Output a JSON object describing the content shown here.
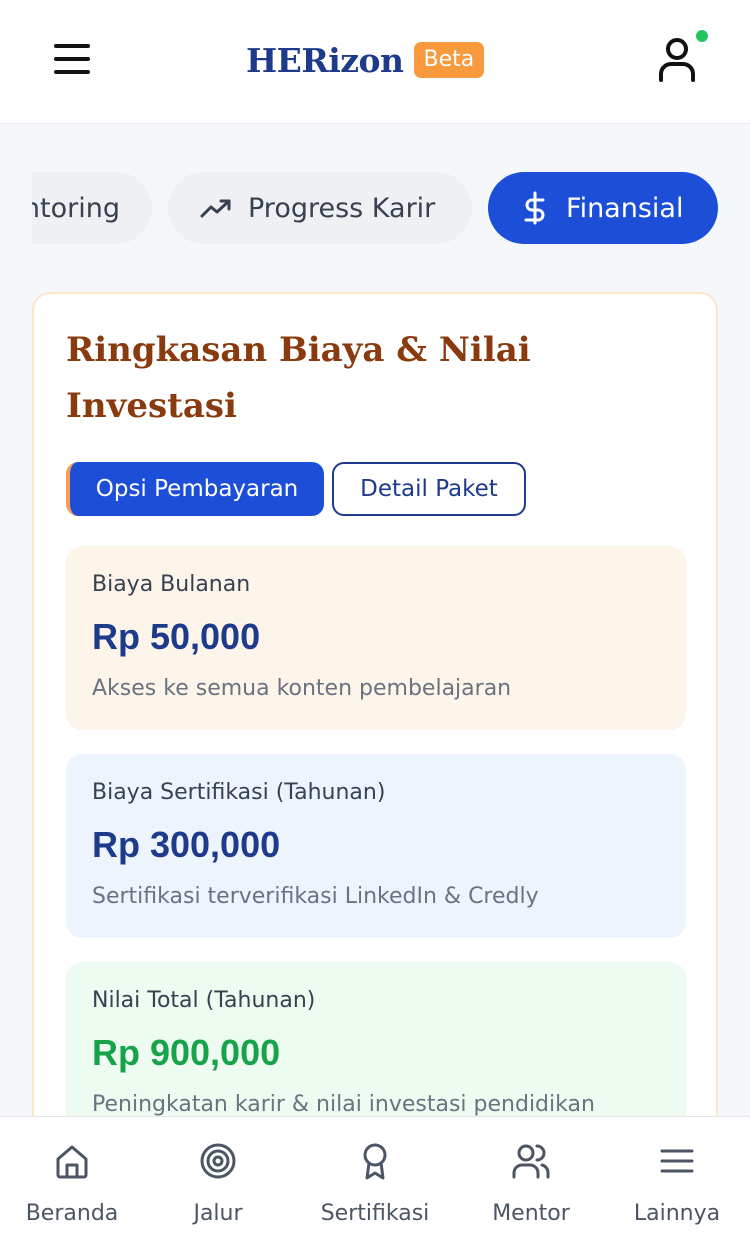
{
  "header": {
    "brand": "HERizon",
    "badge": "Beta",
    "menu_icon": "hamburger-menu-icon",
    "user_icon": "user-icon",
    "status_color": "#22c55e"
  },
  "tabs": [
    {
      "label": "ntoring",
      "icon": null,
      "active": false
    },
    {
      "label": "Progress Karir",
      "icon": "trending-up-icon",
      "active": false
    },
    {
      "label": "Finansial",
      "icon": "dollar-icon",
      "active": true
    }
  ],
  "card": {
    "title": "Ringkasan Biaya & Nilai Investasi",
    "toggles": {
      "active": "Opsi Pembayaran",
      "inactive": "Detail Paket"
    },
    "costs": [
      {
        "label": "Biaya Bulanan",
        "value": "Rp 50,000",
        "desc": "Akses ke semua konten pembelajaran"
      },
      {
        "label": "Biaya Sertifikasi (Tahunan)",
        "value": "Rp 300,000",
        "desc": "Sertifikasi terverifikasi LinkedIn & Credly"
      },
      {
        "label": "Nilai Total (Tahunan)",
        "value": "Rp 900,000",
        "desc": "Peningkatan karir & nilai investasi pendidikan"
      }
    ]
  },
  "bottom_nav": [
    {
      "label": "Beranda",
      "icon": "home-icon"
    },
    {
      "label": "Jalur",
      "icon": "target-icon"
    },
    {
      "label": "Sertifikasi",
      "icon": "award-icon"
    },
    {
      "label": "Mentor",
      "icon": "users-icon"
    },
    {
      "label": "Lainnya",
      "icon": "menu-icon"
    }
  ],
  "colors": {
    "primary": "#1d4ed8",
    "brand": "#1e3a8a",
    "accent": "#f79a3e",
    "title": "#8a3a0f",
    "green": "#16a34a"
  }
}
